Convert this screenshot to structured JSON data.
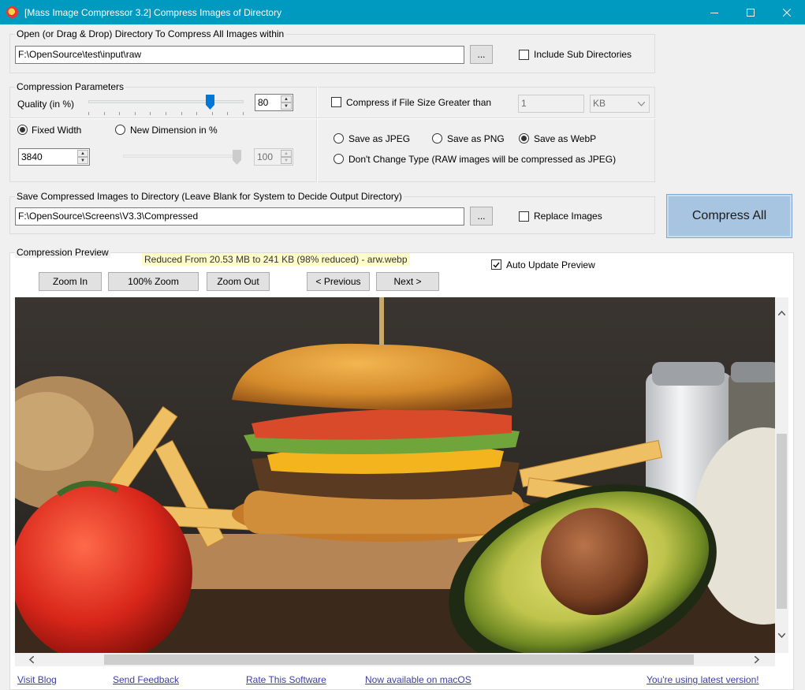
{
  "window": {
    "title": "[Mass Image Compressor 3.2] Compress Images of Directory"
  },
  "input_group": {
    "label": "Open (or Drag & Drop) Directory To Compress All Images within",
    "path": "F:\\OpenSource\\test\\input\\raw",
    "browse_label": "...",
    "include_sub_label": "Include Sub Directories",
    "include_sub_checked": false
  },
  "compression": {
    "label": "Compression Parameters",
    "quality_label": "Quality (in %)",
    "quality_value": "80",
    "quality_level": 0.8,
    "compress_if_label": "Compress if File Size Greater than",
    "compress_if_checked": false,
    "size_value": "1",
    "size_unit": "KB",
    "fixed_width_label": "Fixed Width",
    "fixed_width_selected": true,
    "new_dimension_label": "New Dimension in %",
    "new_dimension_selected": false,
    "width_value": "3840",
    "dimension_value": "100",
    "dimension_level": 1.0,
    "save_jpeg_label": "Save as JPEG",
    "save_png_label": "Save as PNG",
    "save_webp_label": "Save as WebP",
    "dont_change_label": "Don't Change Type (RAW images will be compressed as JPEG)",
    "selected_format": "webp"
  },
  "output_group": {
    "label": "Save Compressed Images to Directory (Leave Blank for System to Decide Output Directory)",
    "path": "F:\\OpenSource\\Screens\\V3.3\\Compressed",
    "browse_label": "...",
    "replace_label": "Replace Images",
    "replace_checked": false
  },
  "compress_all_label": "Compress All",
  "preview": {
    "label": "Compression Preview",
    "status": "Reduced From 20.53 MB to 241 KB (98% reduced) - arw.webp",
    "auto_update_label": "Auto Update Preview",
    "auto_update_checked": true,
    "zoom_in": "Zoom In",
    "zoom_100": "100% Zoom",
    "zoom_out": "Zoom Out",
    "previous": "< Previous",
    "next": "Next >"
  },
  "footer": {
    "visit_blog": "Visit Blog",
    "send_feedback": "Send Feedback",
    "rate": "Rate This Software",
    "mac": "Now available on macOS",
    "version": "You're using latest version!"
  },
  "colors": {
    "titlebar": "#0099bf",
    "accent_blue": "#0078d7",
    "compress_button": "#a7c5e0",
    "link": "#3c3ca8"
  }
}
